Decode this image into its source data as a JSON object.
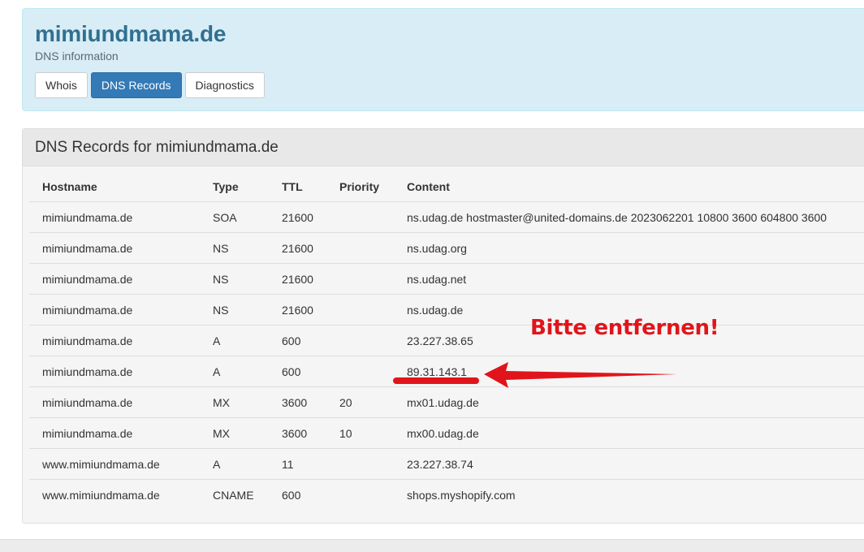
{
  "header": {
    "title": "mimiundmama.de",
    "subtitle": "DNS information",
    "tabs": [
      {
        "label": "Whois",
        "active": false
      },
      {
        "label": "DNS Records",
        "active": true
      },
      {
        "label": "Diagnostics",
        "active": false
      }
    ]
  },
  "panel": {
    "heading": "DNS Records for mimiundmama.de",
    "columns": [
      "Hostname",
      "Type",
      "TTL",
      "Priority",
      "Content"
    ],
    "rows": [
      {
        "hostname": "mimiundmama.de",
        "type": "SOA",
        "ttl": "21600",
        "priority": "",
        "content": "ns.udag.de hostmaster@united-domains.de 2023062201 10800 3600 604800 3600"
      },
      {
        "hostname": "mimiundmama.de",
        "type": "NS",
        "ttl": "21600",
        "priority": "",
        "content": "ns.udag.org"
      },
      {
        "hostname": "mimiundmama.de",
        "type": "NS",
        "ttl": "21600",
        "priority": "",
        "content": "ns.udag.net"
      },
      {
        "hostname": "mimiundmama.de",
        "type": "NS",
        "ttl": "21600",
        "priority": "",
        "content": "ns.udag.de"
      },
      {
        "hostname": "mimiundmama.de",
        "type": "A",
        "ttl": "600",
        "priority": "",
        "content": "23.227.38.65"
      },
      {
        "hostname": "mimiundmama.de",
        "type": "A",
        "ttl": "600",
        "priority": "",
        "content": "89.31.143.1"
      },
      {
        "hostname": "mimiundmama.de",
        "type": "MX",
        "ttl": "3600",
        "priority": "20",
        "content": "mx01.udag.de"
      },
      {
        "hostname": "mimiundmama.de",
        "type": "MX",
        "ttl": "3600",
        "priority": "10",
        "content": "mx00.udag.de"
      },
      {
        "hostname": "www.mimiundmama.de",
        "type": "A",
        "ttl": "11",
        "priority": "",
        "content": "23.227.38.74"
      },
      {
        "hostname": "www.mimiundmama.de",
        "type": "CNAME",
        "ttl": "600",
        "priority": "",
        "content": "shops.myshopify.com"
      }
    ]
  },
  "annotation": {
    "text": "Bitte entfernen!",
    "color": "#e0151b"
  },
  "colors": {
    "hero_bg": "#d9edf7",
    "title": "#31708f",
    "active_tab": "#337ab7"
  }
}
